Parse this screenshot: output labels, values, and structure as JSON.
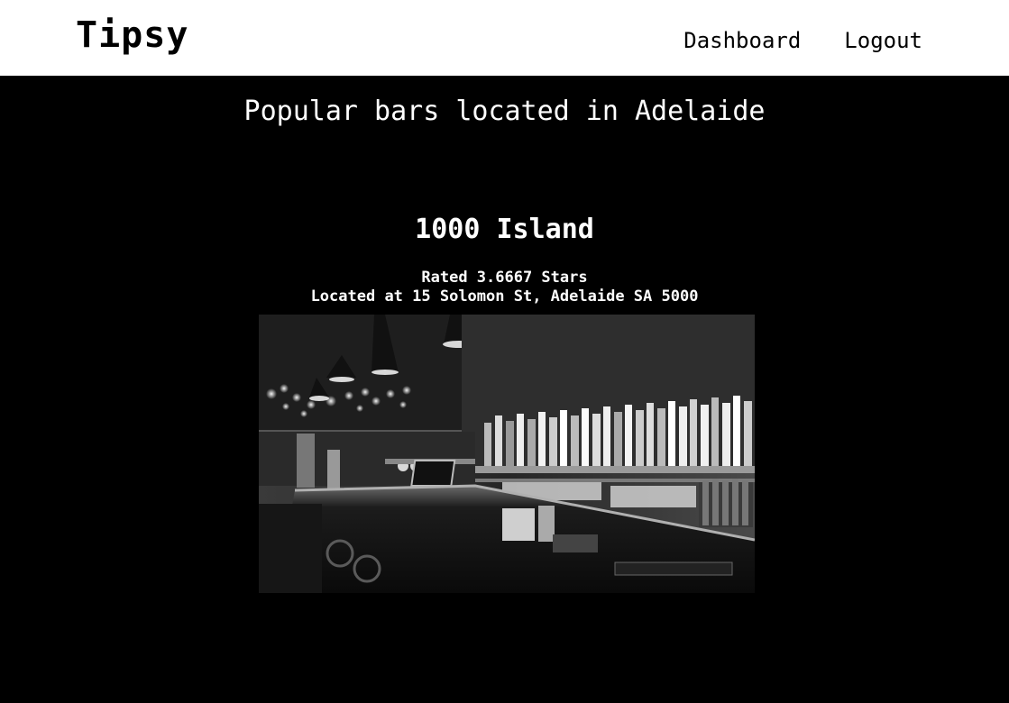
{
  "navbar": {
    "brand": "Tipsy",
    "links": [
      {
        "label": "Dashboard"
      },
      {
        "label": "Logout"
      }
    ]
  },
  "main": {
    "heading": "Popular bars located in Adelaide",
    "bars": [
      {
        "name": "1000 Island",
        "rating_text": "Rated 3.6667 Stars",
        "location_text": "Located at 15 Solomon St, Adelaide SA 5000",
        "rating": 3.6667,
        "photo_description_icon": "bar-interior-photo"
      }
    ]
  },
  "colors": {
    "navbar_bg": "#ffffff",
    "page_bg": "#000000",
    "text_light": "#ffffff",
    "text_dark": "#000000"
  }
}
